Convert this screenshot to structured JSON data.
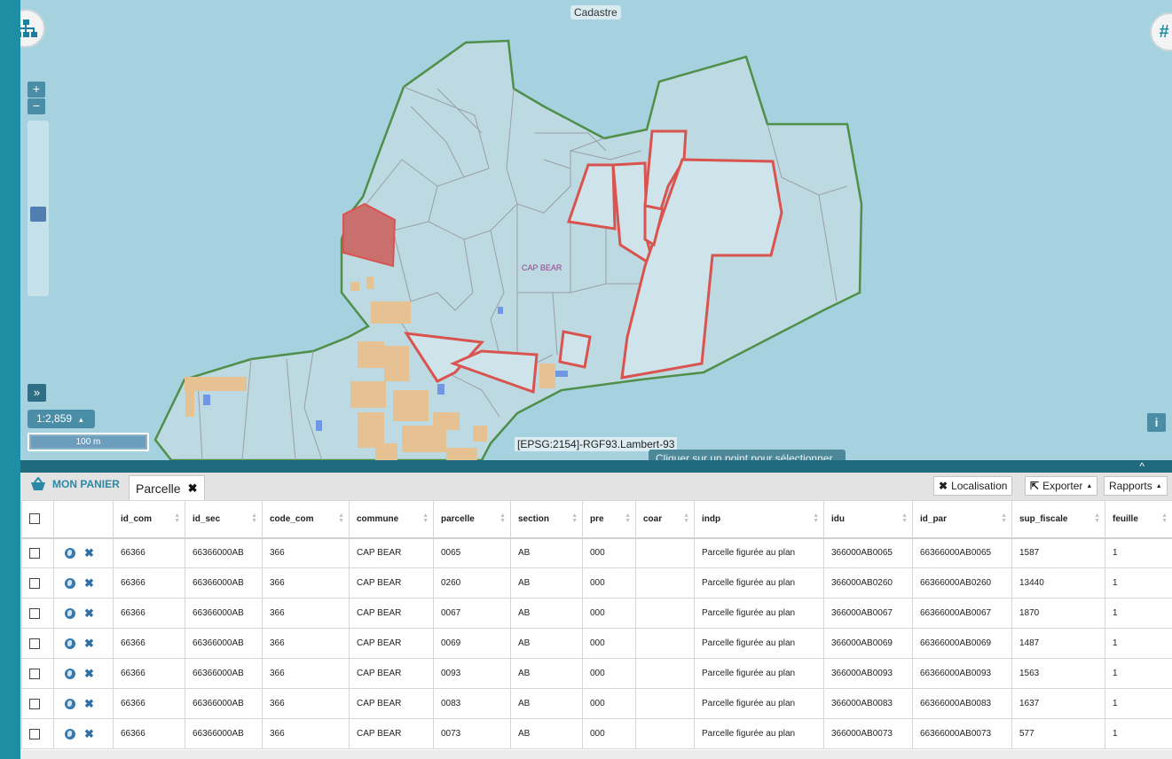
{
  "map": {
    "layer_title": "Cadastre",
    "commune_label": "CAP BEAR",
    "zoom_in": "+",
    "zoom_out": "−",
    "expand": "»",
    "scale": "1:2,859",
    "scale_bar": "100 m",
    "projection": "[EPSG:2154]-RGF93.Lambert-93",
    "click_hint": "Cliquer sur un point pour sélectionner",
    "info": "i",
    "colors": {
      "water": "#a6d2df",
      "parcel_fill": "#bdd9e2",
      "parcel_line": "#9aa0a4",
      "selected_line": "#d9534f",
      "commune_boundary": "#4f8f4a",
      "building": "#e6c191"
    }
  },
  "panel": {
    "basket_label": "MON PANIER",
    "tab_label": "Parcelle",
    "buttons": {
      "localisation": "Localisation",
      "exporter": "Exporter",
      "rapports": "Rapports"
    },
    "columns": [
      "id_com",
      "id_sec",
      "code_com",
      "commune",
      "parcelle",
      "section",
      "pre",
      "coar",
      "indp",
      "idu",
      "id_par",
      "sup_fiscale",
      "feuille"
    ],
    "rows": [
      [
        "66366",
        "66366000AB",
        "366",
        "CAP BEAR",
        "0065",
        "AB",
        "000",
        "",
        "Parcelle figurée au plan",
        "366000AB0065",
        "66366000AB0065",
        "1587",
        "1"
      ],
      [
        "66366",
        "66366000AB",
        "366",
        "CAP BEAR",
        "0260",
        "AB",
        "000",
        "",
        "Parcelle figurée au plan",
        "366000AB0260",
        "66366000AB0260",
        "13440",
        "1"
      ],
      [
        "66366",
        "66366000AB",
        "366",
        "CAP BEAR",
        "0067",
        "AB",
        "000",
        "",
        "Parcelle figurée au plan",
        "366000AB0067",
        "66366000AB0067",
        "1870",
        "1"
      ],
      [
        "66366",
        "66366000AB",
        "366",
        "CAP BEAR",
        "0069",
        "AB",
        "000",
        "",
        "Parcelle figurée au plan",
        "366000AB0069",
        "66366000AB0069",
        "1487",
        "1"
      ],
      [
        "66366",
        "66366000AB",
        "366",
        "CAP BEAR",
        "0093",
        "AB",
        "000",
        "",
        "Parcelle figurée au plan",
        "366000AB0093",
        "66366000AB0093",
        "1563",
        "1"
      ],
      [
        "66366",
        "66366000AB",
        "366",
        "CAP BEAR",
        "0083",
        "AB",
        "000",
        "",
        "Parcelle figurée au plan",
        "366000AB0083",
        "66366000AB0083",
        "1637",
        "1"
      ],
      [
        "66366",
        "66366000AB",
        "366",
        "CAP BEAR",
        "0073",
        "AB",
        "000",
        "",
        "Parcelle figurée au plan",
        "366000AB0073",
        "66366000AB0073",
        "577",
        "1"
      ]
    ]
  }
}
